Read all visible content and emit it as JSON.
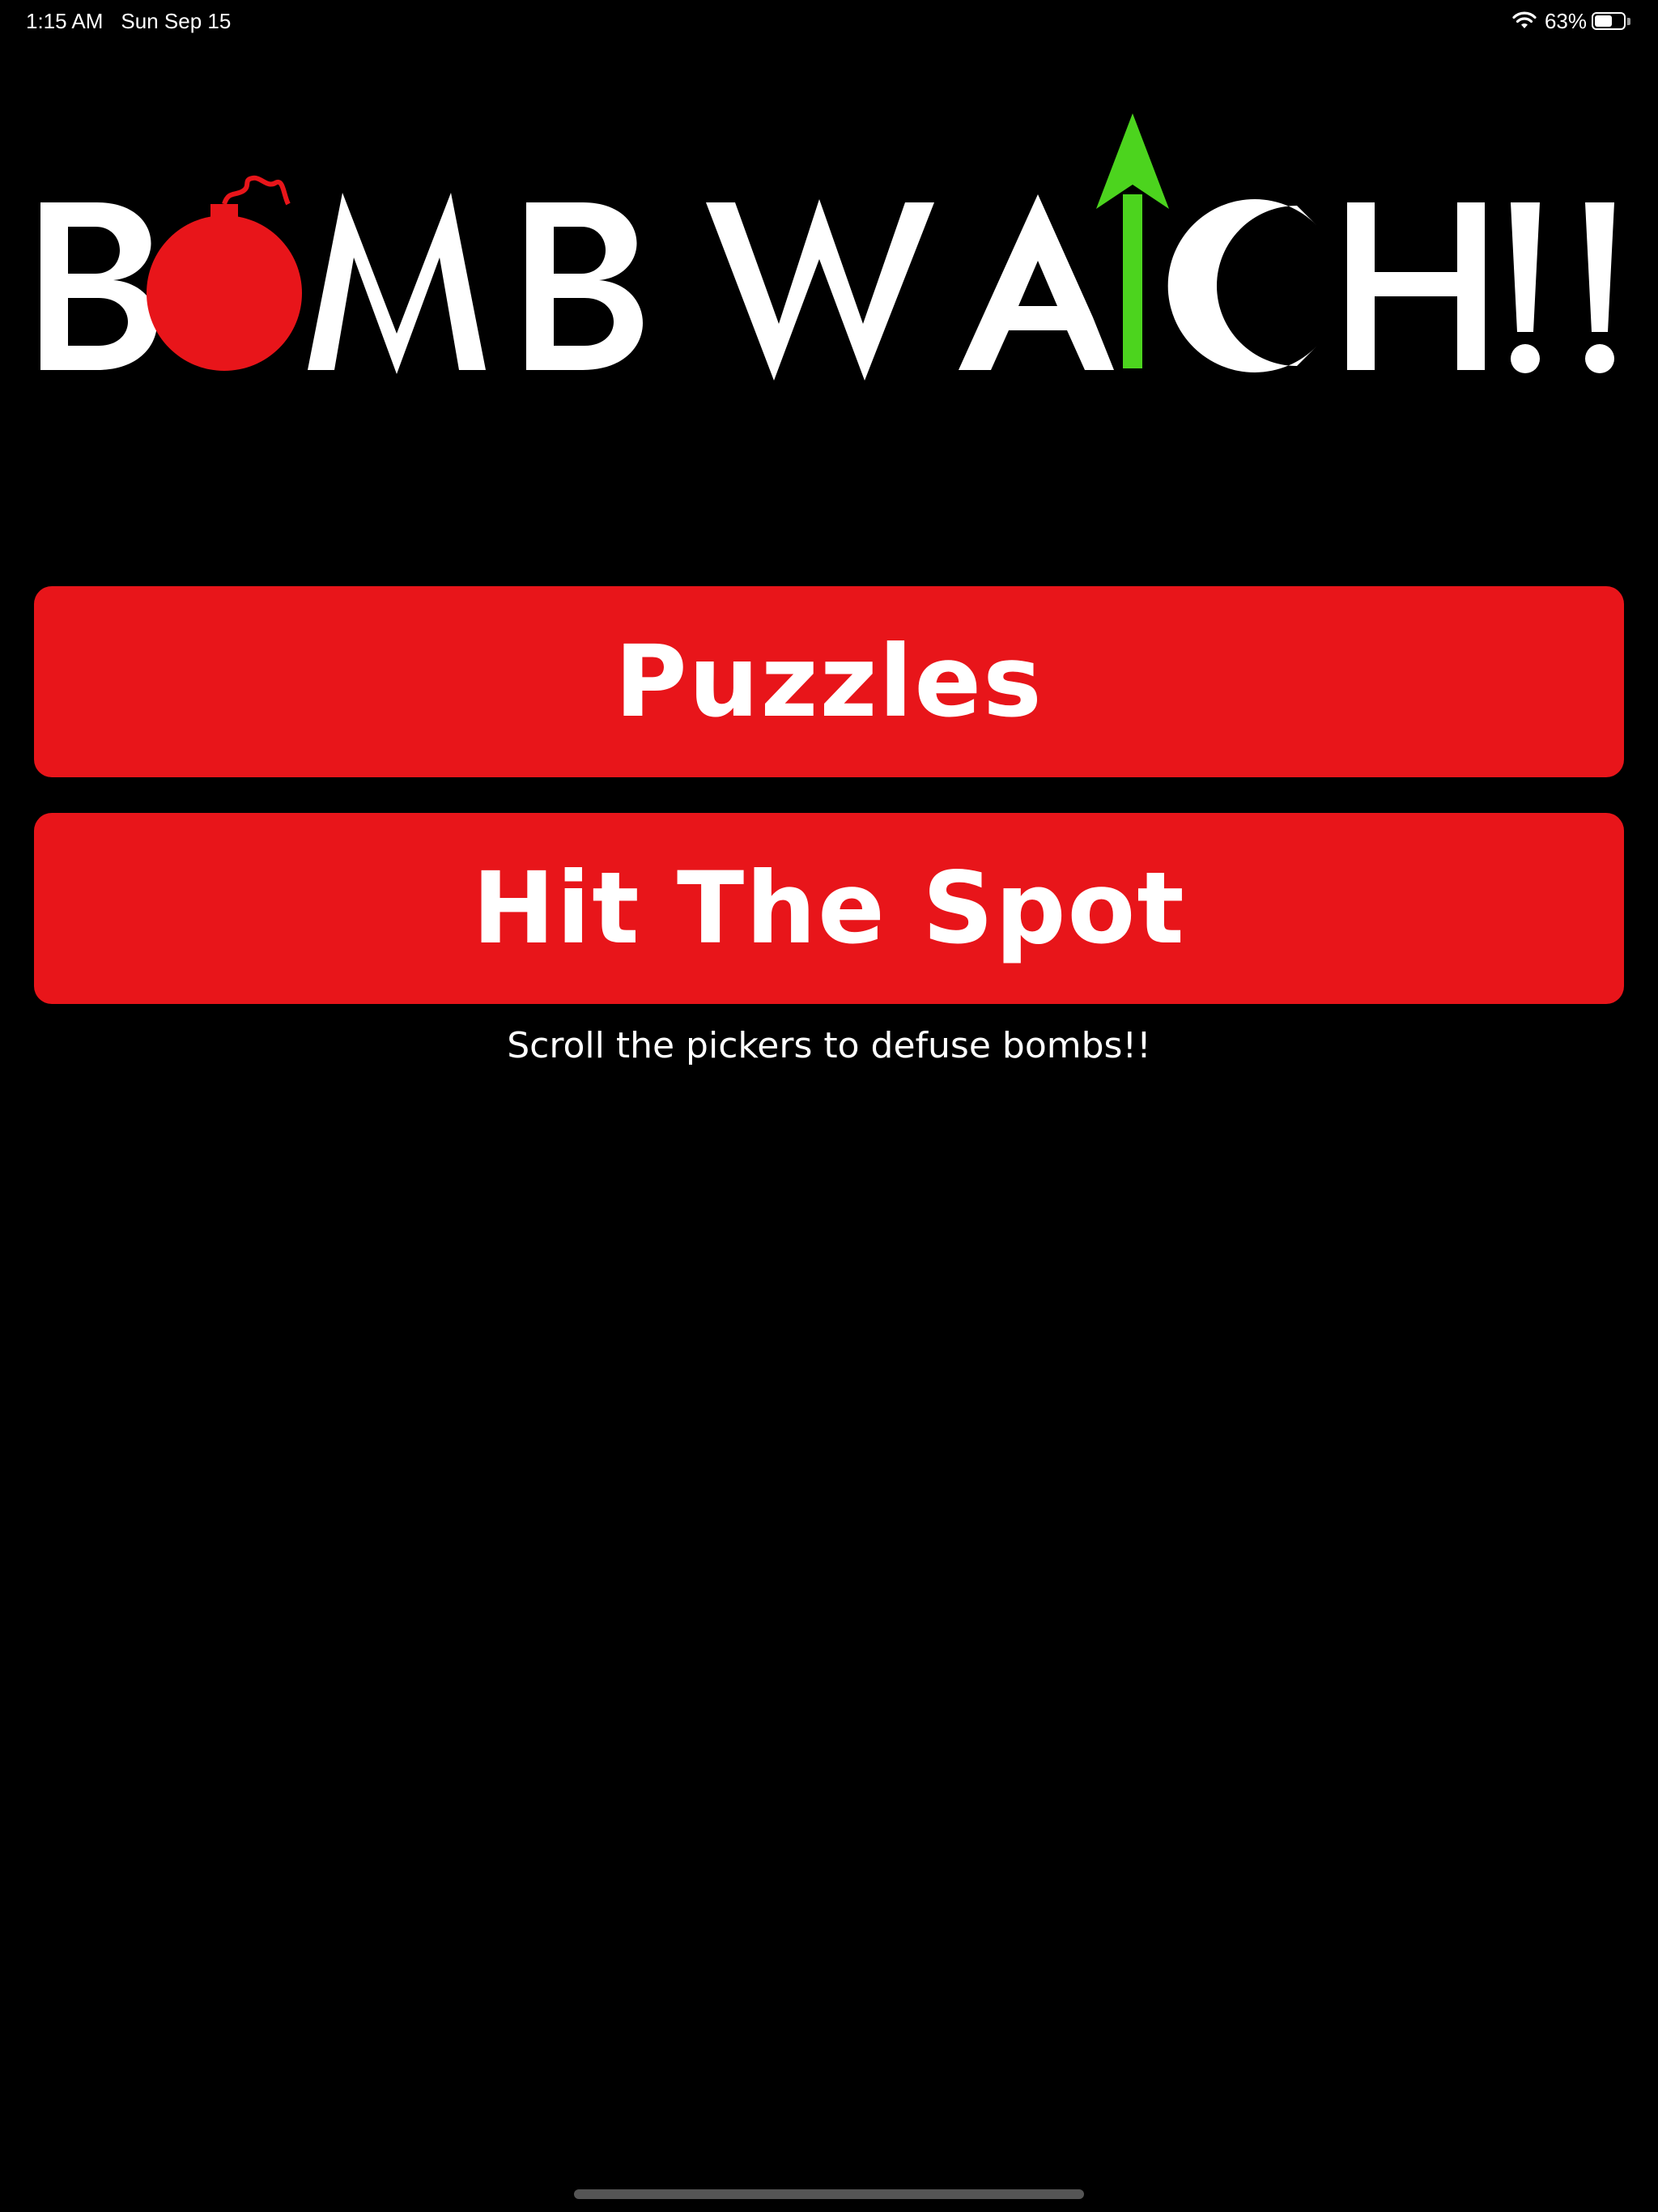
{
  "status_bar": {
    "time": "1:15 AM",
    "date": "Sun Sep 15",
    "battery_percent_label": "63%",
    "battery_level": 0.63,
    "wifi_icon": "wifi-icon",
    "battery_icon": "battery-icon"
  },
  "logo": {
    "letters": [
      "B",
      "O",
      "M",
      "B",
      "W",
      "A",
      "T",
      "C",
      "H",
      "!",
      "!"
    ],
    "bomb_color": "#e8151a",
    "arrow_color": "#4cd41e",
    "text_color": "#ffffff"
  },
  "menu": {
    "puzzles_label": "Puzzles",
    "hit_the_spot_label": "Hit The Spot",
    "button_color": "#e8151a"
  },
  "subtitle": "Scroll the pickers to defuse bombs!!"
}
